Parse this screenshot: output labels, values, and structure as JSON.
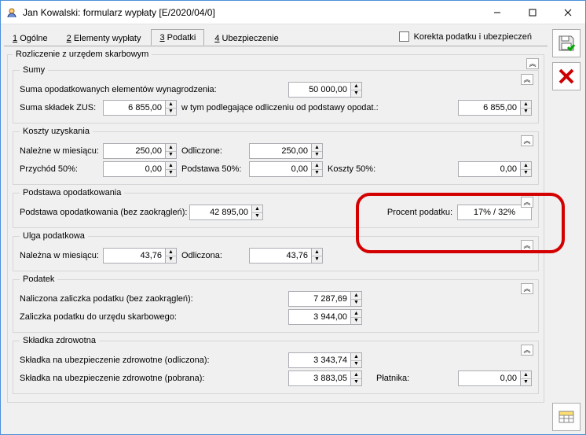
{
  "window": {
    "title": "Jan Kowalski: formularz wypłaty [E/2020/04/0]"
  },
  "tabs": {
    "t1": "Ogólne",
    "t2": "Elementy wypłaty",
    "t3": "Podatki",
    "t4": "Ubezpieczenie"
  },
  "checkbox": {
    "korekta": "Korekta podatku i ubezpieczeń"
  },
  "groups": {
    "rozliczenie": "Rozliczenie z urzędem skarbowym",
    "sumy": "Sumy",
    "koszty": "Koszty uzyskania",
    "podstawa": "Podstawa opodatkowania",
    "ulga": "Ulga podatkowa",
    "podatek": "Podatek",
    "zdrowotna": "Składka zdrowotna"
  },
  "fields": {
    "suma_opodat_label": "Suma opodatkowanych elementów wynagrodzenia:",
    "suma_opodat_val": "50 000,00",
    "suma_zus_label": "Suma składek ZUS:",
    "suma_zus_val": "6 855,00",
    "w_tym_label": "w tym podlegające odliczeniu od podstawy opodat.:",
    "w_tym_val": "6 855,00",
    "nalezne_label": "Należne w miesiącu:",
    "nalezne_val": "250,00",
    "odliczone_label": "Odliczone:",
    "odliczone_val": "250,00",
    "przychod_label": "Przychód 50%:",
    "przychod_val": "0,00",
    "podstawa50_label": "Podstawa 50%:",
    "podstawa50_val": "0,00",
    "koszty50_label": "Koszty 50%:",
    "koszty50_val": "0,00",
    "podst_opodat_label": "Podstawa opodatkowania (bez zaokrągleń):",
    "podst_opodat_val": "42 895,00",
    "procent_label": "Procent podatku:",
    "procent_val": "17% / 32%",
    "ulga_nal_label": "Należna w miesiącu:",
    "ulga_nal_val": "43,76",
    "ulga_odl_label": "Odliczona:",
    "ulga_odl_val": "43,76",
    "nalicz_label": "Naliczona zaliczka podatku (bez zaokrągleń):",
    "nalicz_val": "7 287,69",
    "zal_label": "Zaliczka podatku do urzędu skarbowego:",
    "zal_val": "3 944,00",
    "zdr_odl_label": "Składka na ubezpieczenie zdrowotne (odliczona):",
    "zdr_odl_val": "3 343,74",
    "zdr_pob_label": "Składka na ubezpieczenie zdrowotne (pobrana):",
    "zdr_pob_val": "3 883,05",
    "platnika_label": "Płatnika:",
    "platnika_val": "0,00"
  },
  "collapse_glyph": "︽"
}
